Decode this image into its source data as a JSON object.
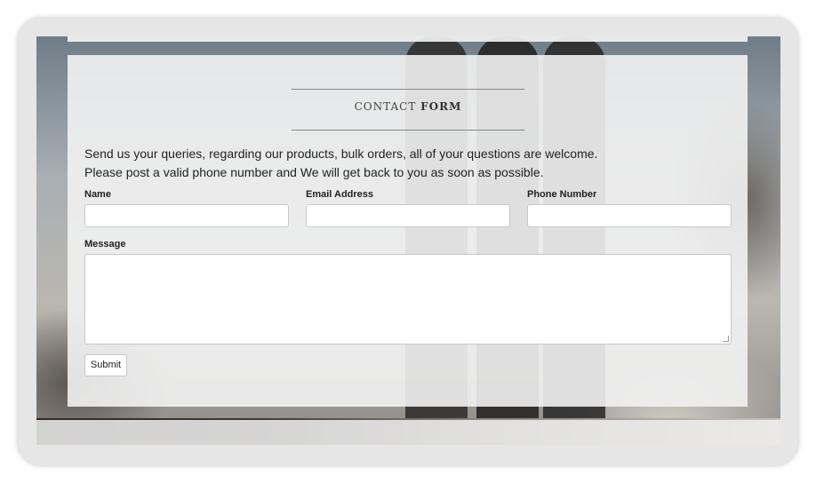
{
  "form": {
    "title_light": "CONTACT",
    "title_bold": "FORM",
    "intro_line1": "Send us your queries, regarding our products, bulk orders, all of your questions are welcome.",
    "intro_line2": "Please post a valid phone number and We will get back to you as soon as possible.",
    "fields": {
      "name_label": "Name",
      "email_label": "Email Address",
      "phone_label": "Phone Number",
      "message_label": "Message",
      "name_value": "",
      "email_value": "",
      "phone_value": "",
      "message_value": ""
    },
    "submit_label": "Submit"
  }
}
